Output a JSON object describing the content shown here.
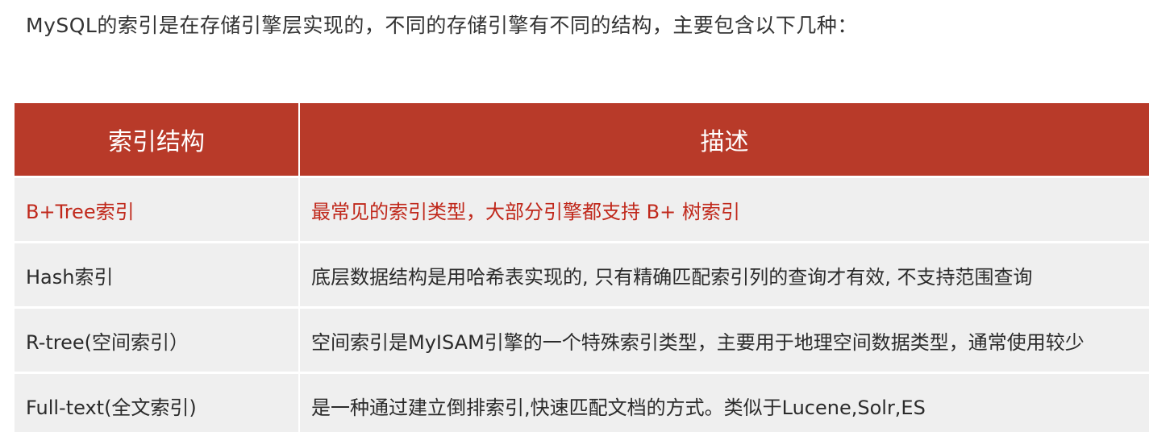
{
  "intro_text": "MySQL的索引是在存储引擎层实现的，不同的存储引擎有不同的结构，主要包含以下几种：",
  "table": {
    "headers": [
      "索引结构",
      "描述"
    ],
    "rows": [
      {
        "structure": "B+Tree索引",
        "description": "最常见的索引类型，大部分引擎都支持 B+ 树索引",
        "highlight": true
      },
      {
        "structure": "Hash索引",
        "description": "底层数据结构是用哈希表实现的, 只有精确匹配索引列的查询才有效, 不支持范围查询",
        "highlight": false
      },
      {
        "structure": "R-tree(空间索引）",
        "description": "空间索引是MyISAM引擎的一个特殊索引类型，主要用于地理空间数据类型，通常使用较少",
        "highlight": false
      },
      {
        "structure": "Full-text(全文索引)",
        "description": "是一种通过建立倒排索引,快速匹配文档的方式。类似于Lucene,Solr,ES",
        "highlight": false
      }
    ]
  },
  "colors": {
    "header_bg": "#b83a29",
    "highlight_text": "#c0281b",
    "row_bg": "#efefef"
  }
}
